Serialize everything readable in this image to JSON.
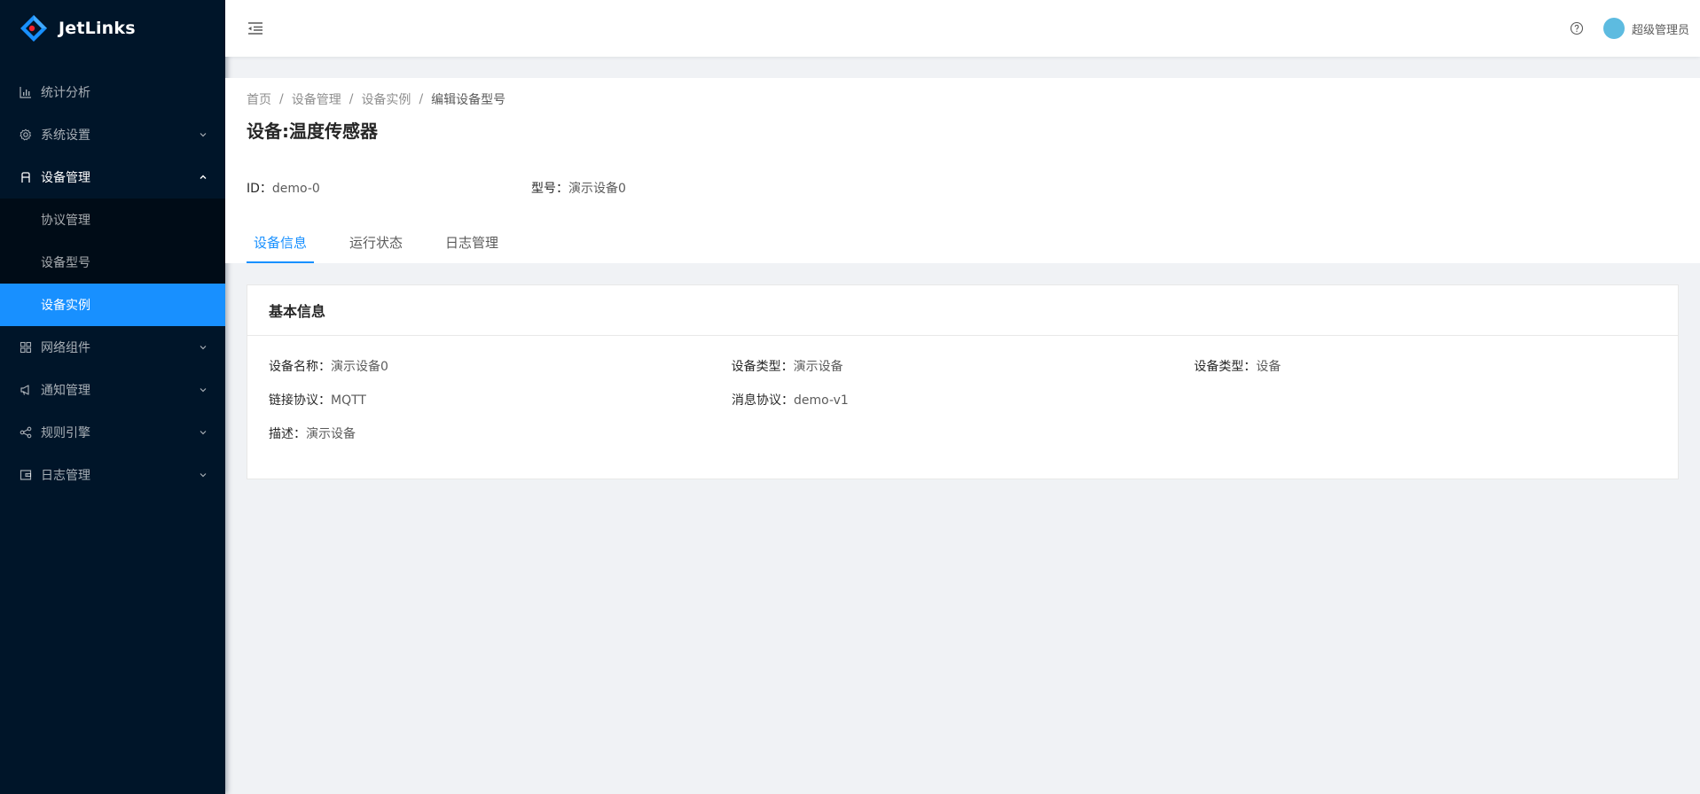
{
  "app": {
    "name": "JetLinks"
  },
  "sidebar": {
    "items": [
      {
        "label": "统计分析",
        "icon": "bar-chart-icon",
        "arrow": false
      },
      {
        "label": "系统设置",
        "icon": "settings-icon",
        "arrow": "down"
      },
      {
        "label": "设备管理",
        "icon": "device-icon",
        "arrow": "up",
        "open": true,
        "children": [
          {
            "label": "协议管理"
          },
          {
            "label": "设备型号"
          },
          {
            "label": "设备实例",
            "selected": true
          }
        ]
      },
      {
        "label": "网络组件",
        "icon": "appstore-icon",
        "arrow": "down"
      },
      {
        "label": "通知管理",
        "icon": "notification-icon",
        "arrow": "down"
      },
      {
        "label": "规则引擎",
        "icon": "share-icon",
        "arrow": "down"
      },
      {
        "label": "日志管理",
        "icon": "wallet-icon",
        "arrow": "down"
      }
    ]
  },
  "header": {
    "user": "超级管理员"
  },
  "breadcrumb": [
    "首页",
    "设备管理",
    "设备实例",
    "编辑设备型号"
  ],
  "page": {
    "title": "设备:温度传感器",
    "meta": [
      {
        "label": "ID：",
        "value": "demo-0"
      },
      {
        "label": "型号：",
        "value": "演示设备0"
      }
    ],
    "tabs": [
      "设备信息",
      "运行状态",
      "日志管理"
    ]
  },
  "card": {
    "title": "基本信息",
    "rows": [
      [
        {
          "label": "设备名称：",
          "value": "演示设备0"
        },
        {
          "label": "设备类型：",
          "value": "演示设备"
        },
        {
          "label": "设备类型：",
          "value": "设备"
        }
      ],
      [
        {
          "label": "链接协议：",
          "value": "MQTT"
        },
        {
          "label": "消息协议：",
          "value": "demo-v1"
        }
      ],
      [
        {
          "label": "描述：",
          "value": "演示设备"
        }
      ]
    ]
  },
  "colors": {
    "sidebar": "#001529",
    "submenu": "#000c17",
    "primary": "#1890ff",
    "avatar": "#5dbbe0"
  }
}
